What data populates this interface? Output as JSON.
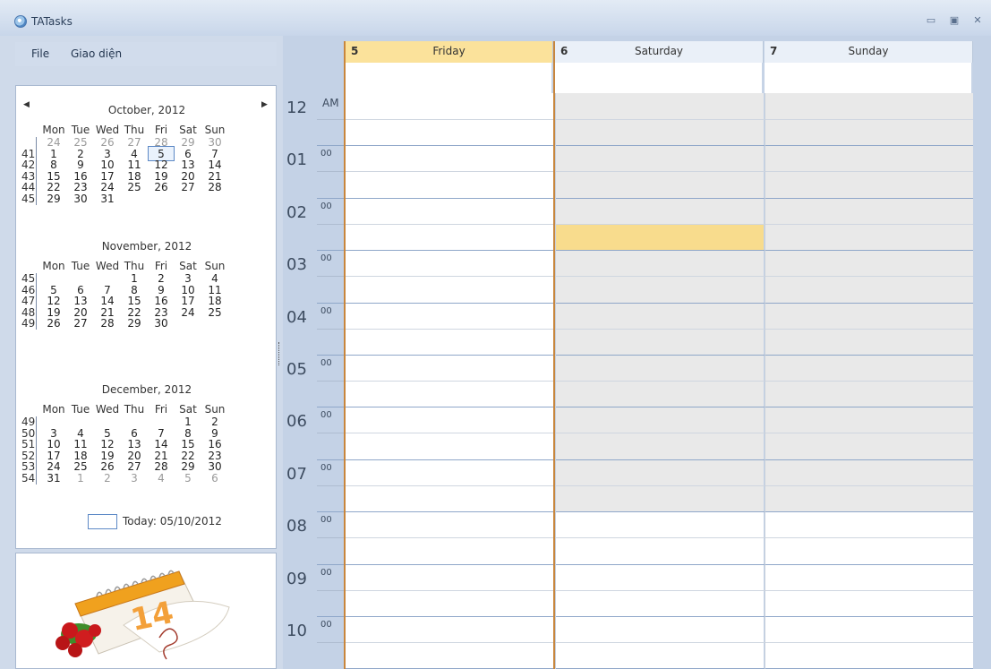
{
  "window": {
    "title": "TATasks",
    "min_icon": "minimize-icon",
    "max_icon": "maximize-icon",
    "close_icon": "close-icon"
  },
  "menu": {
    "file": "File",
    "view": "Giao diện"
  },
  "calendar": {
    "prev_icon": "triangle-left-icon",
    "next_icon": "triangle-right-icon",
    "day_headers": [
      "Mon",
      "Tue",
      "Wed",
      "Thu",
      "Fri",
      "Sat",
      "Sun"
    ],
    "months": [
      {
        "title": "October, 2012",
        "weeks": [
          {
            "num": "",
            "days": [
              "24",
              "25",
              "26",
              "27",
              "28",
              "29",
              "30"
            ],
            "gray": [
              1,
              1,
              1,
              1,
              1,
              1,
              1
            ]
          },
          {
            "num": "41",
            "days": [
              "1",
              "2",
              "3",
              "4",
              "5",
              "6",
              "7"
            ],
            "gray": [
              0,
              0,
              0,
              0,
              0,
              0,
              0
            ]
          },
          {
            "num": "42",
            "days": [
              "8",
              "9",
              "10",
              "11",
              "12",
              "13",
              "14"
            ],
            "gray": [
              0,
              0,
              0,
              0,
              0,
              0,
              0
            ]
          },
          {
            "num": "43",
            "days": [
              "15",
              "16",
              "17",
              "18",
              "19",
              "20",
              "21"
            ],
            "gray": [
              0,
              0,
              0,
              0,
              0,
              0,
              0
            ]
          },
          {
            "num": "44",
            "days": [
              "22",
              "23",
              "24",
              "25",
              "26",
              "27",
              "28"
            ],
            "gray": [
              0,
              0,
              0,
              0,
              0,
              0,
              0
            ]
          },
          {
            "num": "45",
            "days": [
              "29",
              "30",
              "31",
              "",
              "",
              "",
              ""
            ],
            "gray": [
              0,
              0,
              0,
              0,
              0,
              0,
              0
            ]
          }
        ]
      },
      {
        "title": "November, 2012",
        "weeks": [
          {
            "num": "45",
            "days": [
              "",
              "",
              "",
              "1",
              "2",
              "3",
              "4"
            ],
            "gray": [
              0,
              0,
              0,
              0,
              0,
              0,
              0
            ]
          },
          {
            "num": "46",
            "days": [
              "5",
              "6",
              "7",
              "8",
              "9",
              "10",
              "11"
            ],
            "gray": [
              0,
              0,
              0,
              0,
              0,
              0,
              0
            ]
          },
          {
            "num": "47",
            "days": [
              "12",
              "13",
              "14",
              "15",
              "16",
              "17",
              "18"
            ],
            "gray": [
              0,
              0,
              0,
              0,
              0,
              0,
              0
            ]
          },
          {
            "num": "48",
            "days": [
              "19",
              "20",
              "21",
              "22",
              "23",
              "24",
              "25"
            ],
            "gray": [
              0,
              0,
              0,
              0,
              0,
              0,
              0
            ]
          },
          {
            "num": "49",
            "days": [
              "26",
              "27",
              "28",
              "29",
              "30",
              "",
              ""
            ],
            "gray": [
              0,
              0,
              0,
              0,
              0,
              0,
              0
            ]
          }
        ]
      },
      {
        "title": "December, 2012",
        "weeks": [
          {
            "num": "49",
            "days": [
              "",
              "",
              "",
              "",
              "",
              "1",
              "2"
            ],
            "gray": [
              0,
              0,
              0,
              0,
              0,
              0,
              0
            ]
          },
          {
            "num": "50",
            "days": [
              "3",
              "4",
              "5",
              "6",
              "7",
              "8",
              "9"
            ],
            "gray": [
              0,
              0,
              0,
              0,
              0,
              0,
              0
            ]
          },
          {
            "num": "51",
            "days": [
              "10",
              "11",
              "12",
              "13",
              "14",
              "15",
              "16"
            ],
            "gray": [
              0,
              0,
              0,
              0,
              0,
              0,
              0
            ]
          },
          {
            "num": "52",
            "days": [
              "17",
              "18",
              "19",
              "20",
              "21",
              "22",
              "23"
            ],
            "gray": [
              0,
              0,
              0,
              0,
              0,
              0,
              0
            ]
          },
          {
            "num": "53",
            "days": [
              "24",
              "25",
              "26",
              "27",
              "28",
              "29",
              "30"
            ],
            "gray": [
              0,
              0,
              0,
              0,
              0,
              0,
              0
            ]
          },
          {
            "num": "54",
            "days": [
              "31",
              "1",
              "2",
              "3",
              "4",
              "5",
              "6"
            ],
            "gray": [
              0,
              1,
              1,
              1,
              1,
              1,
              1
            ]
          }
        ]
      }
    ],
    "today_label": "Today: 05/10/2012"
  },
  "side_image": {
    "icon": "calendar-14-with-roses-icon"
  },
  "dayview": {
    "columns": [
      {
        "num": "5",
        "name": "Friday"
      },
      {
        "num": "6",
        "name": "Saturday"
      },
      {
        "num": "7",
        "name": "Sunday"
      }
    ],
    "time_labels": [
      {
        "hour": "12",
        "minute": "AM"
      },
      {
        "hour": "01",
        "minute": "00"
      },
      {
        "hour": "02",
        "minute": "00"
      },
      {
        "hour": "03",
        "minute": "00"
      },
      {
        "hour": "04",
        "minute": "00"
      },
      {
        "hour": "05",
        "minute": "00"
      },
      {
        "hour": "06",
        "minute": "00"
      },
      {
        "hour": "07",
        "minute": "00"
      },
      {
        "hour": "08",
        "minute": "00"
      },
      {
        "hour": "09",
        "minute": "00"
      },
      {
        "hour": "10",
        "minute": "00"
      }
    ],
    "colors": {
      "selected_header": "#fbe29b",
      "selected_border": "#c8863d",
      "event_fill": "#f8dc8d",
      "hour_line": "#8fa7c9"
    }
  }
}
